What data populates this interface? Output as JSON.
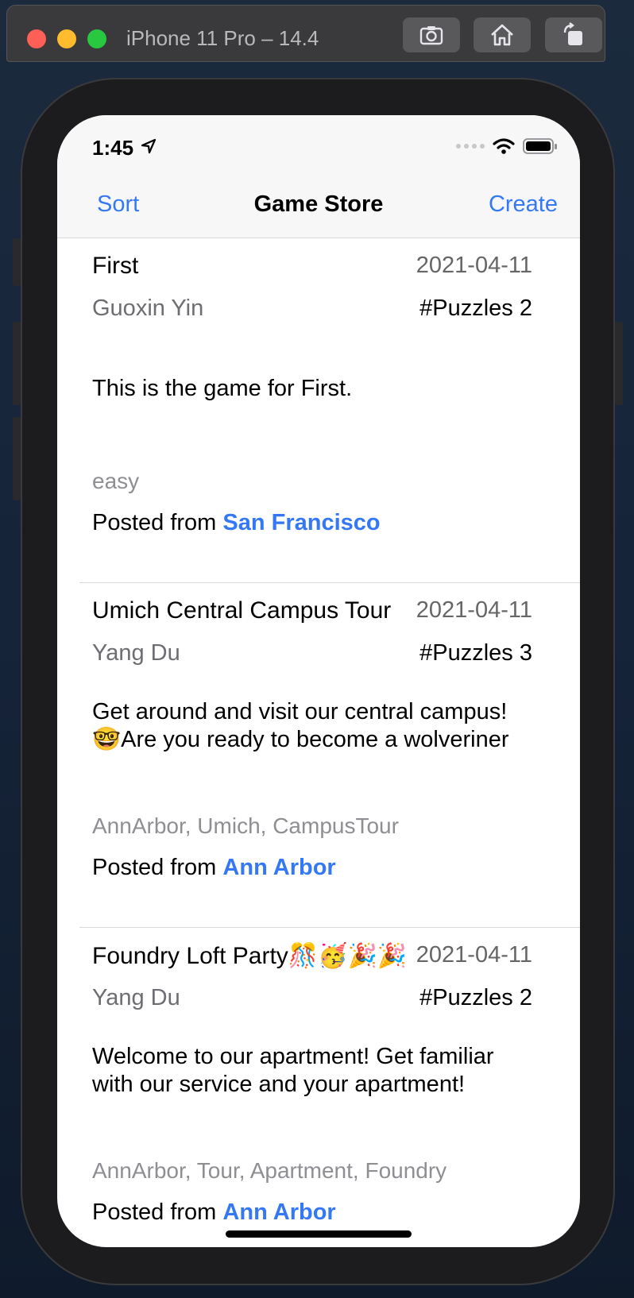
{
  "simulator": {
    "title": "iPhone 11 Pro – 14.4",
    "buttons": [
      "camera-icon",
      "home-icon",
      "rotate-icon"
    ]
  },
  "status_bar": {
    "time": "1:45"
  },
  "nav": {
    "left": "Sort",
    "title": "Game Store",
    "right": "Create"
  },
  "games": [
    {
      "title": "First",
      "date": "2021-04-11",
      "author": "Guoxin Yin",
      "puzzles": "#Puzzles 2",
      "description": "This is the game for First.",
      "tags": "easy",
      "posted_prefix": "Posted from ",
      "location": "San Francisco"
    },
    {
      "title": "Umich Central Campus Tour",
      "date": "2021-04-11",
      "author": "Yang Du",
      "puzzles": "#Puzzles 3",
      "description": "Get around and visit our central campus! 🤓Are you ready to become a wolveriner",
      "tags": "AnnArbor, Umich, CampusTour",
      "posted_prefix": "Posted from ",
      "location": "Ann Arbor"
    },
    {
      "title": "Foundry Loft Party🎊🥳🎉🎉",
      "date": "2021-04-11",
      "author": "Yang Du",
      "puzzles": "#Puzzles 2",
      "description": "Welcome to our apartment! Get familiar with our service and your apartment!",
      "tags": "AnnArbor, Tour, Apartment, Foundry",
      "posted_prefix": "Posted from ",
      "location": "Ann Arbor"
    }
  ],
  "colors": {
    "accent": "#3478f6",
    "secondary_text": "#6d6d72",
    "tag_text": "#8e8e93"
  }
}
